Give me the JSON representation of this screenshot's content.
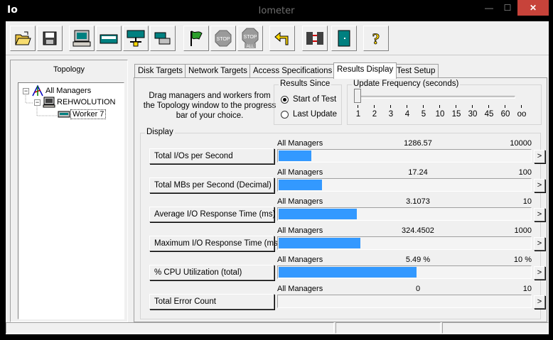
{
  "window": {
    "app_abbr": "Io",
    "title": "Iometer",
    "min_label": "—",
    "max_label": "☐",
    "close_label": "✕"
  },
  "toolbar": {
    "buttons": [
      "open-config-icon",
      "save-config-icon",
      "new-disk-worker-icon",
      "new-network-worker-icon",
      "new-manager-icon",
      "duplicate-worker-icon",
      "start-tests-icon",
      "stop-test-icon",
      "stop-all-icon",
      "reset-workers-icon",
      "exit-icon",
      "quit-icon",
      "help-icon"
    ],
    "stop_text": "STOP",
    "stop_all_text": "ALL",
    "help_text": "?"
  },
  "topology": {
    "title": "Topology",
    "root": "All Managers",
    "manager": "REHWOLUTION",
    "worker": "Worker 7",
    "expanded_glyph": "−"
  },
  "tabs": [
    {
      "label": "Disk Targets",
      "active": false
    },
    {
      "label": "Network Targets",
      "active": false
    },
    {
      "label": "Access Specifications",
      "active": false
    },
    {
      "label": "Results Display",
      "active": true
    },
    {
      "label": "Test Setup",
      "active": false
    }
  ],
  "results": {
    "intro": "Drag managers and workers from the Topology window to the progress bar of your choice.",
    "results_since": {
      "title": "Results Since",
      "options": [
        {
          "label": "Start of Test",
          "checked": true
        },
        {
          "label": "Last Update",
          "checked": false
        }
      ]
    },
    "update_frequency": {
      "title": "Update Frequency (seconds)",
      "ticks": [
        "1",
        "2",
        "3",
        "4",
        "5",
        "10",
        "15",
        "30",
        "45",
        "60",
        "oo"
      ],
      "selected": "1"
    },
    "display_title": "Display",
    "metrics": [
      {
        "name": "Total I/Os per Second",
        "source": "All Managers",
        "value": "1286.57",
        "max": "10000",
        "fraction": 0.1287
      },
      {
        "name": "Total MBs per Second (Decimal)",
        "source": "All Managers",
        "value": "17.24",
        "max": "100",
        "fraction": 0.1724
      },
      {
        "name": "Average I/O Response Time (ms)",
        "source": "All Managers",
        "value": "3.1073",
        "max": "10",
        "fraction": 0.3107
      },
      {
        "name": "Maximum I/O Response Time (ms)",
        "source": "All Managers",
        "value": "324.4502",
        "max": "1000",
        "fraction": 0.3245
      },
      {
        "name": "% CPU Utilization (total)",
        "source": "All Managers",
        "value": "5.49 %",
        "max": "10 %",
        "fraction": 0.549
      },
      {
        "name": "Total Error Count",
        "source": "All Managers",
        "value": "0",
        "max": "10",
        "fraction": 0
      }
    ],
    "arrow_glyph": ">"
  },
  "colors": {
    "bar_fill": "#3399ff",
    "close_button": "#c7433a",
    "titlebar": "#000000"
  }
}
